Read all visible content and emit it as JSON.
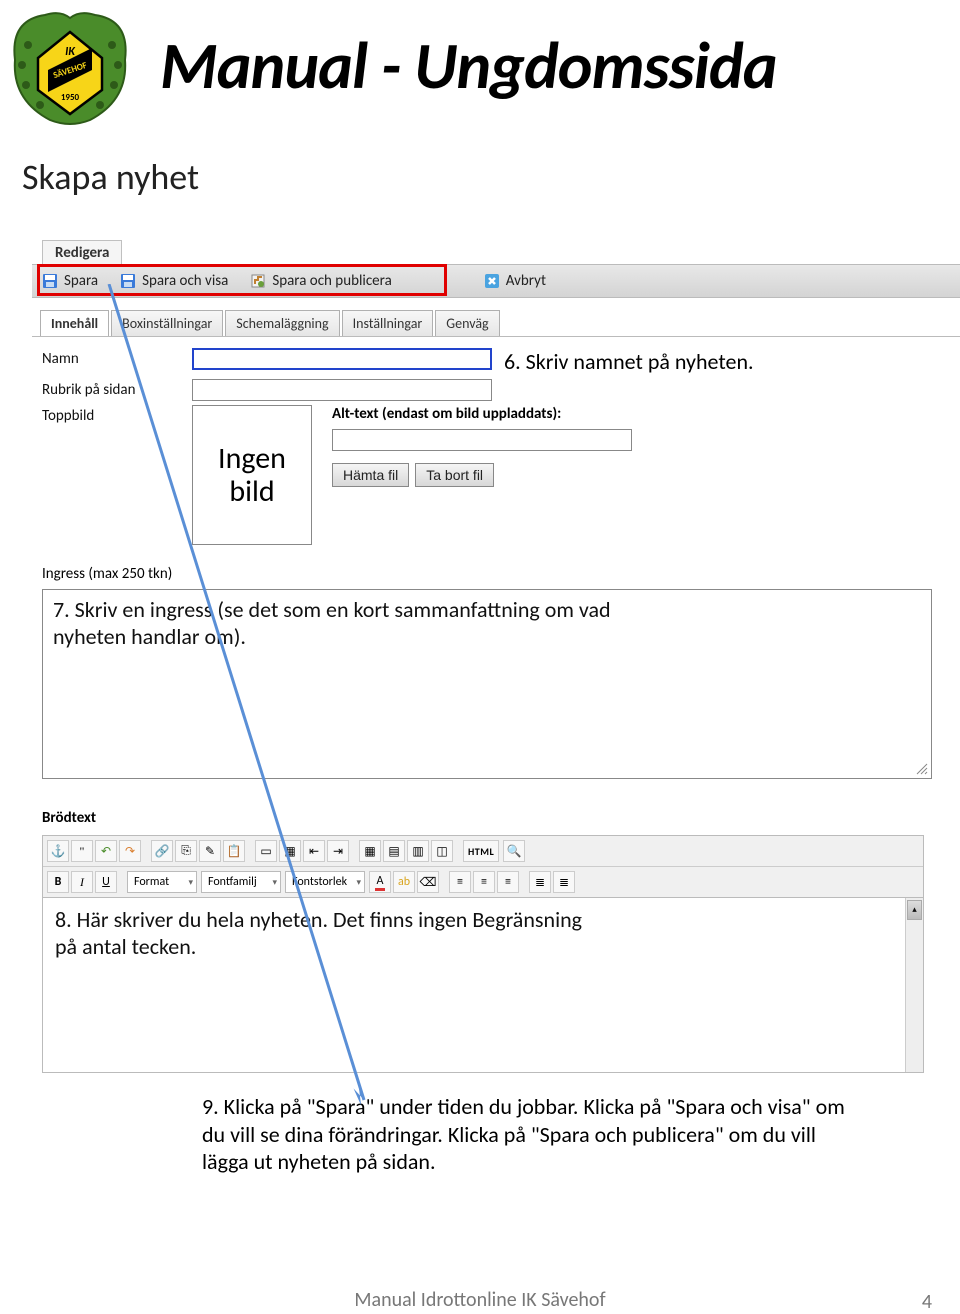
{
  "page": {
    "title": "Manual - Ungdomssida",
    "section": "Skapa nyhet",
    "footer": "Manual Idrottonline IK Sävehof",
    "page_number": "4"
  },
  "menu_tab": "Redigera",
  "toolbar": {
    "spara": "Spara",
    "spara_visa": "Spara och visa",
    "spara_pub": "Spara och publicera",
    "avbryt": "Avbryt"
  },
  "subtabs": [
    "Innehåll",
    "Boxinställningar",
    "Schemaläggning",
    "Inställningar",
    "Genväg"
  ],
  "form": {
    "namn": "Namn",
    "rubrik": "Rubrik på sidan",
    "toppbild": "Toppbild",
    "toppbild_box": "Ingen bild",
    "alt_label": "Alt-text (endast om bild uppladdats):",
    "hamta": "Hämta fil",
    "tabort": "Ta bort fil",
    "ingress": "Ingress (max 250 tkn)",
    "brodtext": "Brödtext"
  },
  "editor": {
    "format": "Format",
    "fontfamilj": "Fontfamilj",
    "fontstorlek": "Fontstorlek",
    "html": "HTML"
  },
  "instructions": {
    "i6": "6. Skriv namnet på nyheten.",
    "i7": "7. Skriv en ingress (se det som en kort sammanfattning om vad nyheten handlar om).",
    "i8": "8. Här skriver du hela nyheten. Det finns ingen Begränsning på antal tecken.",
    "i9": "9. Klicka på \"Spara\" under tiden du jobbar. Klicka på \"Spara och visa\" om du vill se dina förändringar. Klicka på \"Spara och publicera\" om du vill lägga ut nyheten på sidan."
  }
}
